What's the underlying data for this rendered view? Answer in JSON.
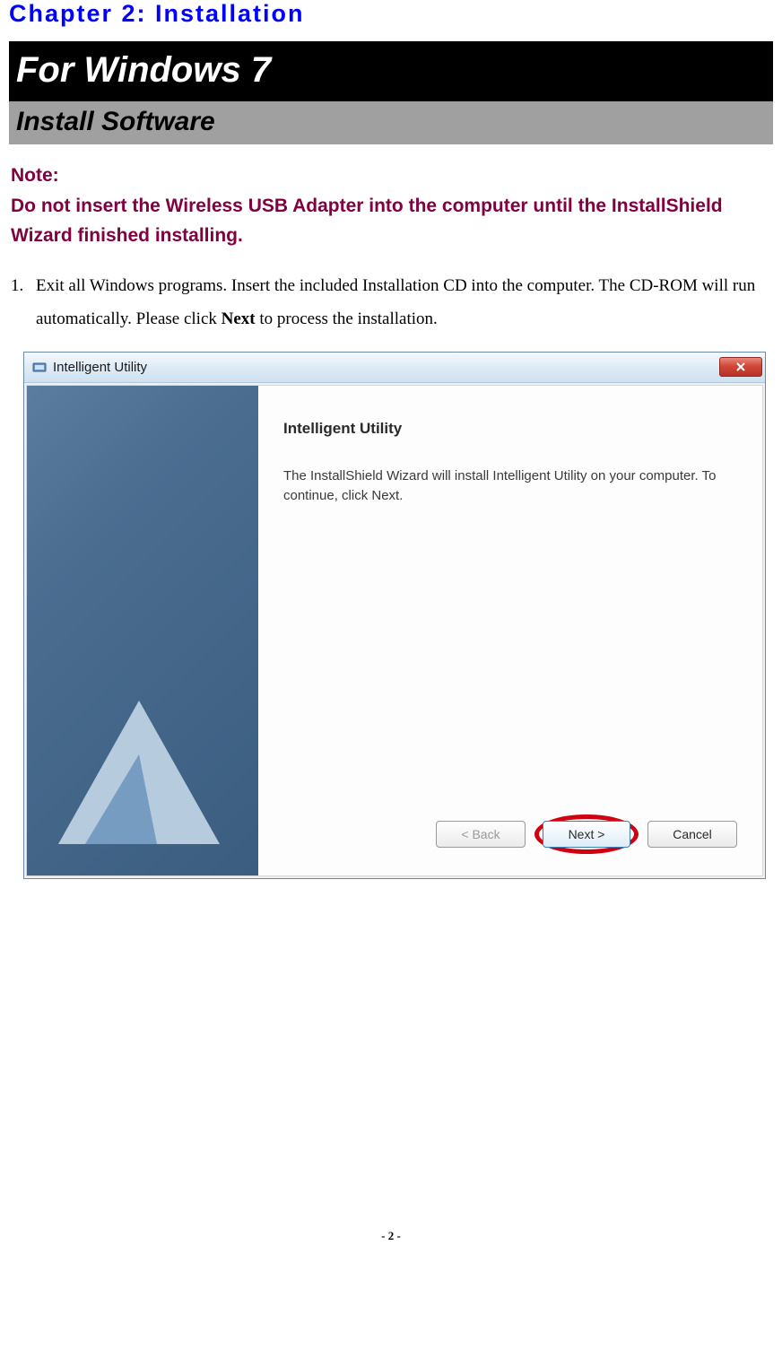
{
  "chapter_title": "Chapter 2: Installation",
  "section_windows": "For Windows 7",
  "section_install": "Install Software",
  "note": {
    "label": "Note:",
    "text": "Do not insert the Wireless USB Adapter into the computer until the InstallShield Wizard finished installing."
  },
  "steps": [
    {
      "num": "1.",
      "text_before": "Exit all Windows programs. Insert the included Installation CD into the computer. The CD-ROM will run automatically. Please click ",
      "bold": "Next",
      "text_after": " to process the installation."
    }
  ],
  "dialog": {
    "title": "Intelligent Utility",
    "wizard_heading": "Intelligent Utility",
    "wizard_body": "The InstallShield Wizard will install Intelligent Utility on your computer.  To continue, click Next.",
    "buttons": {
      "back": "< Back",
      "next": "Next >",
      "cancel": "Cancel"
    }
  },
  "page_number": "- 2 -"
}
